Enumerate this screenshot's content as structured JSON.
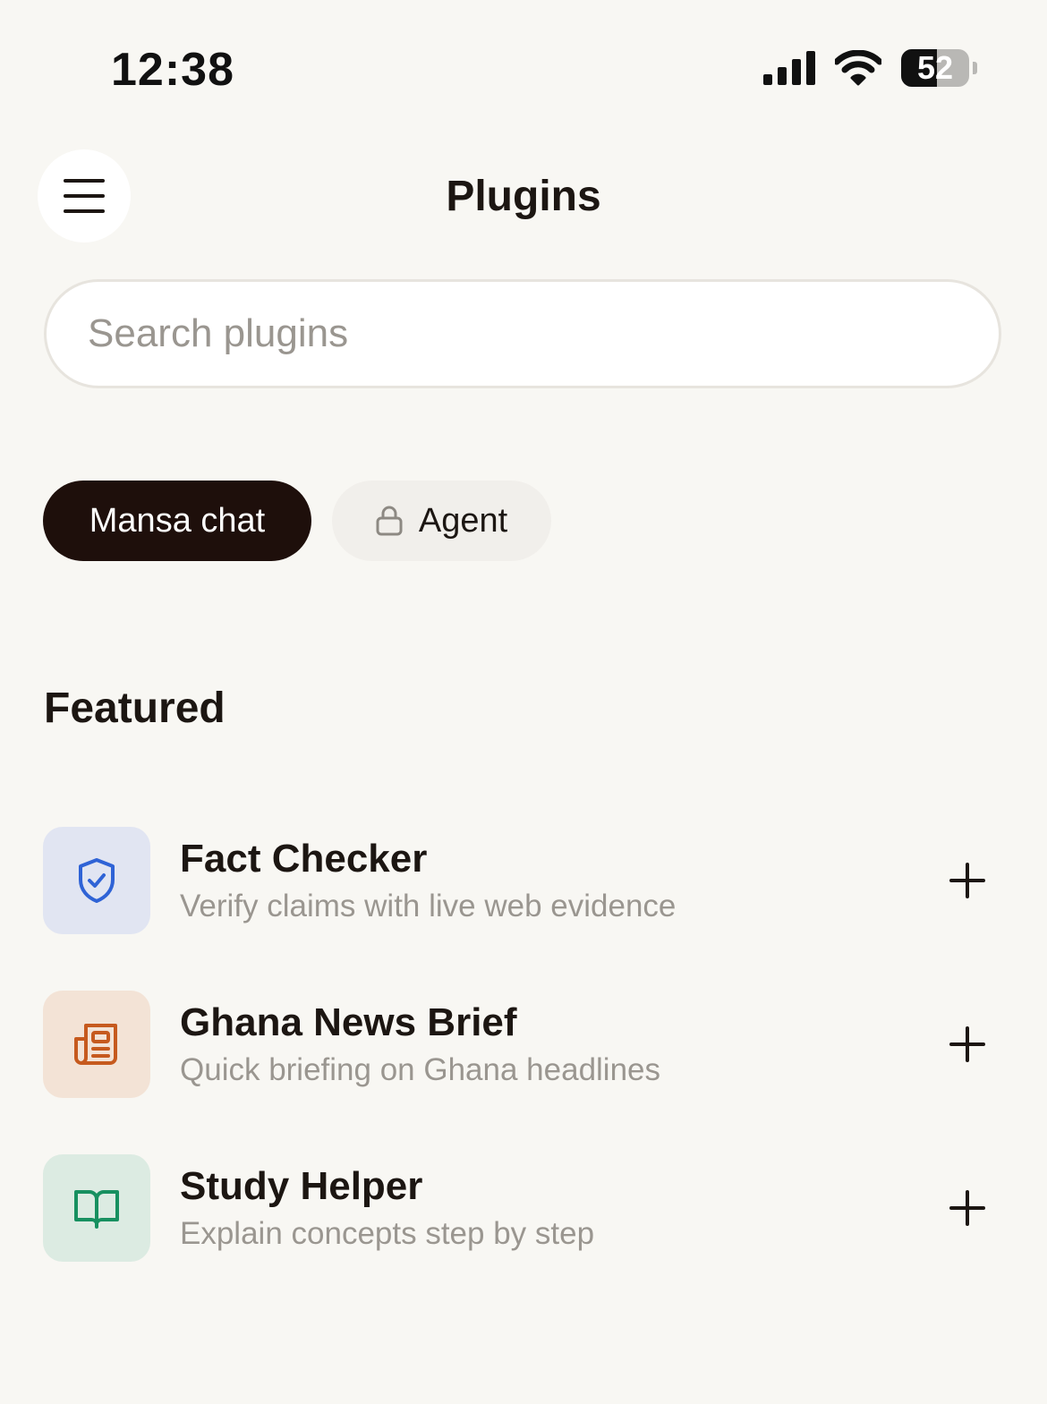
{
  "status_bar": {
    "time": "12:38",
    "battery_level": "52",
    "battery_fraction": 0.52
  },
  "header": {
    "title": "Plugins",
    "menu_icon": "hamburger-menu-icon"
  },
  "search": {
    "placeholder": "Search plugins",
    "value": ""
  },
  "tabs": [
    {
      "label": "Mansa chat",
      "selected": true
    },
    {
      "label": "Agent",
      "selected": false,
      "icon": "lock-icon"
    }
  ],
  "featured": {
    "title": "Featured",
    "items": [
      {
        "name": "Fact Checker",
        "description": "Verify claims with live web evidence",
        "icon": "shield-check-icon",
        "icon_bg": "#e1e5f2",
        "icon_color": "#2f63d6"
      },
      {
        "name": "Ghana News Brief",
        "description": "Quick briefing on Ghana headlines",
        "icon": "newspaper-icon",
        "icon_bg": "#f3e3d6",
        "icon_color": "#c65a1e"
      },
      {
        "name": "Study Helper",
        "description": "Explain concepts step by step",
        "icon": "open-book-icon",
        "icon_bg": "#dcebe2",
        "icon_color": "#179060"
      }
    ]
  },
  "colors": {
    "background": "#f8f7f3",
    "accent_dark": "#1e0f0b",
    "muted_text": "#9a9690"
  }
}
